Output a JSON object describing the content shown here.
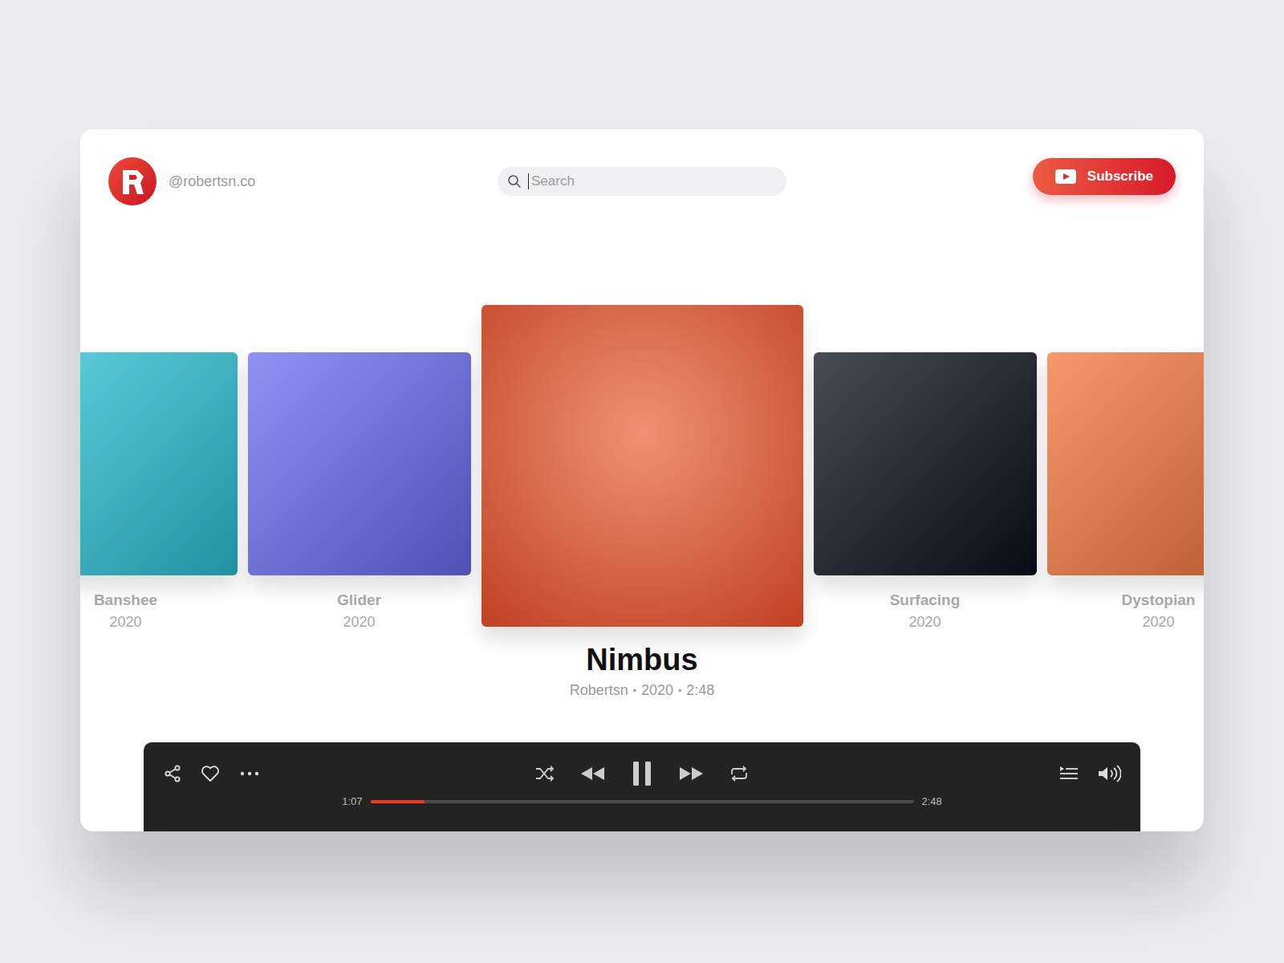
{
  "account": {
    "handle": "@robertsn.co"
  },
  "search": {
    "placeholder": "Search"
  },
  "subscribe_button": {
    "label": "Subscribe"
  },
  "albums": [
    {
      "title": "Banshee",
      "year": "2020",
      "selected": false,
      "color": "#2cc3d6"
    },
    {
      "title": "Glider",
      "year": "2020",
      "selected": false,
      "color": "#6a6cf0"
    },
    {
      "title": "Nimbus",
      "year": "2020",
      "selected": true,
      "color": "#e0542f"
    },
    {
      "title": "Surfacing",
      "year": "2020",
      "selected": false,
      "color": "#0b101c"
    },
    {
      "title": "Dystopian",
      "year": "2020",
      "selected": false,
      "color": "#f2763a"
    }
  ],
  "now_playing": {
    "artist": "Robertsn",
    "duration": "2:48",
    "separator": "•"
  },
  "player": {
    "elapsed": "1:07",
    "total": "2:48",
    "level": 0.1,
    "playing": true
  }
}
